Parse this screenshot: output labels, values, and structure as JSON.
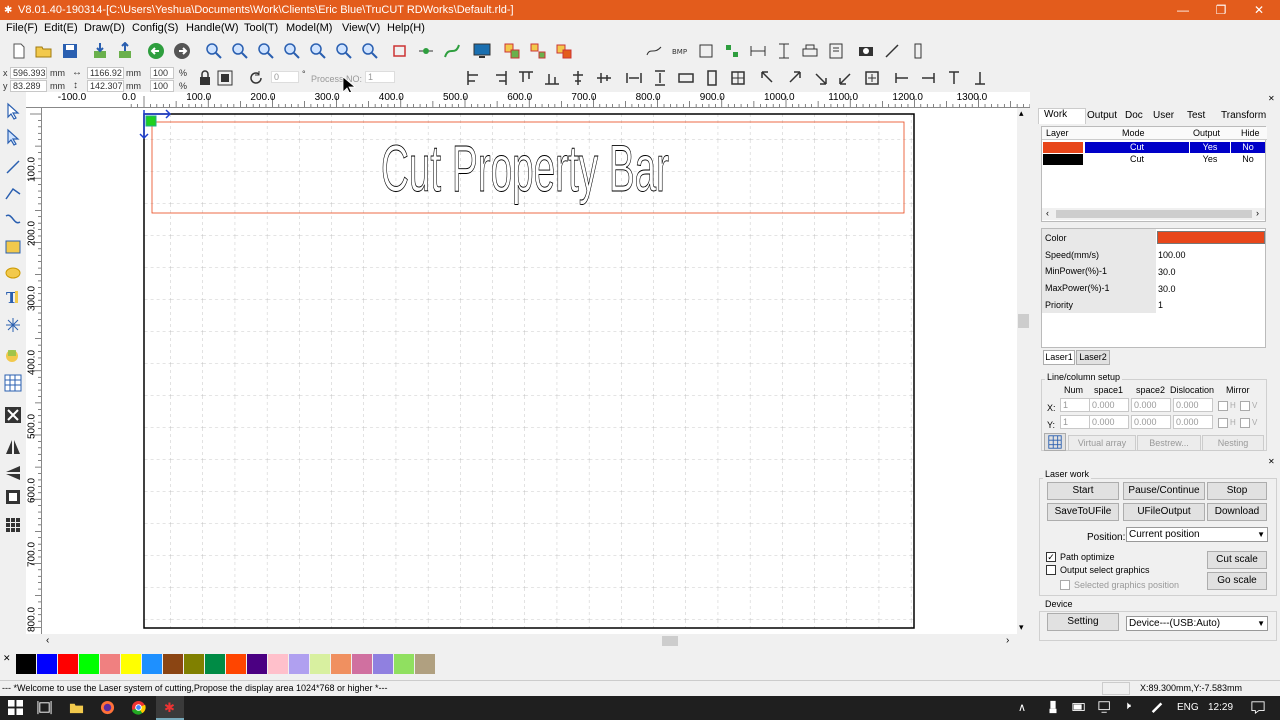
{
  "window": {
    "title": "V8.01.40-190314-[C:\\Users\\Yeshua\\Documents\\Work\\Clients\\Eric Blue\\TruCUT RDWorks\\Default.rld-]",
    "minimize": "—",
    "maximize": "❐",
    "close": "✕"
  },
  "menu": [
    "File(F)",
    "Edit(E)",
    "Draw(D)",
    "Config(S)",
    "Handle(W)",
    "Tool(T)",
    "Model(M)",
    "View(V)",
    "Help(H)"
  ],
  "props": {
    "x_label": "x",
    "x_value": "596.393",
    "x_unit": "mm",
    "y_label": "y",
    "y_value": "83.289",
    "y_unit": "mm",
    "w_value": "1166.92",
    "w_unit": "mm",
    "h_value": "142.307",
    "h_unit": "mm",
    "sx_value": "100",
    "sx_unit": "%",
    "sy_value": "100",
    "sy_unit": "%",
    "rot_value": "0",
    "rot_unit": "°",
    "process_label": "Process NO:",
    "process_value": "1"
  },
  "rulers": {
    "h": [
      "-100.0",
      "0.0",
      "100.0",
      "200.0",
      "300.0",
      "400.0",
      "500.0",
      "600.0",
      "700.0",
      "800.0",
      "900.0",
      "1000.0",
      "1100.0",
      "1200.0",
      "1300.0"
    ],
    "v": [
      "100.0",
      "200.0",
      "300.0",
      "400.0",
      "500.0",
      "600.0",
      "700.0",
      "800.0"
    ]
  },
  "canvas": {
    "text": "Cut Property Bar"
  },
  "palette": {
    "close": "✕",
    "colors": [
      "#000000",
      "#0000ff",
      "#ff0000",
      "#00ff00",
      "#f08080",
      "#ffff00",
      "#1e90ff",
      "#8b4513",
      "#808000",
      "#008b45",
      "#ff4500",
      "#4b0082",
      "#ffc0cb",
      "#b0a0f0",
      "#d8f0a0",
      "#f09060",
      "#d070a0",
      "#9080e0",
      "#90e060",
      "#b0a080"
    ]
  },
  "status": {
    "message": "--- *Welcome to use the Laser system of cutting,Propose the display area 1024*768 or higher *---",
    "coords": "X:89.300mm,Y:-7.583mm"
  },
  "panel": {
    "tabs": [
      "Work",
      "Output",
      "Doc",
      "User",
      "Test",
      "Transform"
    ],
    "layer_headers": [
      "Layer",
      "Mode",
      "Output",
      "Hide"
    ],
    "layers": [
      {
        "color": "#e8461a",
        "mode": "Cut",
        "output": "Yes",
        "hide": "No"
      },
      {
        "color": "#000000",
        "mode": "Cut",
        "output": "Yes",
        "hide": "No"
      }
    ],
    "props": [
      {
        "label": "Color",
        "value": ""
      },
      {
        "label": "Speed(mm/s)",
        "value": "100.00"
      },
      {
        "label": "MinPower(%)-1",
        "value": "30.0"
      },
      {
        "label": "MaxPower(%)-1",
        "value": "30.0"
      },
      {
        "label": "Priority",
        "value": "1"
      }
    ],
    "color_value": "#e8461a",
    "laser_tabs": [
      "Laser1",
      "Laser2"
    ],
    "array": {
      "title": "Line/column setup",
      "headers": [
        "Num",
        "space1",
        "space2",
        "Dislocation",
        "Mirror"
      ],
      "x_label": "X:",
      "y_label": "Y:",
      "x": [
        "1",
        "0.000",
        "0.000",
        "0.000"
      ],
      "y": [
        "1",
        "0.000",
        "0.000",
        "0.000"
      ],
      "mirror_h": "H",
      "mirror_v": "V",
      "virtual": "Virtual array",
      "bestrew": "Bestrew...",
      "nesting": "Nesting"
    },
    "close": "✕"
  },
  "laserwork": {
    "title": "Laser work",
    "close": "✕",
    "start": "Start",
    "pause": "Pause/Continue",
    "stop": "Stop",
    "save_ufile": "SaveToUFile",
    "ufile_output": "UFileOutput",
    "download": "Download",
    "position_label": "Position:",
    "position_value": "Current position",
    "path_optimize": "Path optimize",
    "output_select": "Output select graphics",
    "selected_pos": "Selected graphics position",
    "cut_scale": "Cut scale",
    "go_scale": "Go scale",
    "device_title": "Device",
    "setting": "Setting",
    "device_value": "Device---(USB:Auto)"
  },
  "taskbar": {
    "lang": "ENG",
    "time": "12:29"
  }
}
